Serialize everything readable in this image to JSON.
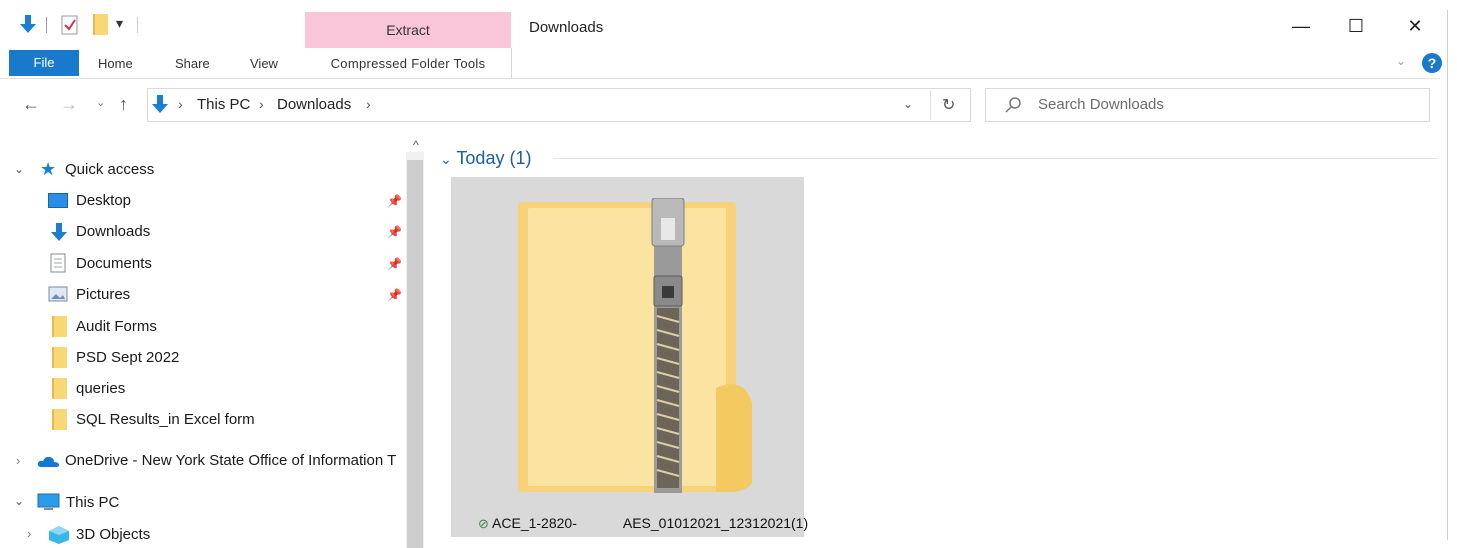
{
  "window": {
    "title": "Downloads",
    "context_tab": "Extract",
    "minimize": "—",
    "maximize": "☐",
    "close": "✕"
  },
  "ribbon": {
    "tabs": [
      "File",
      "Home",
      "Share",
      "View"
    ],
    "context_label": "Compressed Folder Tools",
    "help": "?",
    "collapse": "⌄"
  },
  "address_bar": {
    "path": [
      "This PC",
      "Downloads"
    ],
    "search_placeholder": "Search Downloads"
  },
  "navigation": {
    "quick_access": "Quick access",
    "pinned": [
      "Desktop",
      "Downloads",
      "Documents",
      "Pictures"
    ],
    "folders": [
      "Audit Forms",
      "PSD Sept 2022",
      "queries",
      "SQL Results_in Excel form"
    ],
    "onedrive": "OneDrive - New York State Office of Information T",
    "this_pc": "This PC",
    "objects_3d": "3D Objects"
  },
  "content": {
    "group_header": "Today (1)",
    "file": {
      "name_prefix": "ACE_1-2820-",
      "name_suffix": "AES_01012021_12312021(1)",
      "status_icon": "sync-ok-icon"
    }
  },
  "colors": {
    "accent": "#1979ca",
    "context_tab": "#f9c6d9",
    "folder": "#f8d775",
    "selection": "#d9d9d9"
  }
}
